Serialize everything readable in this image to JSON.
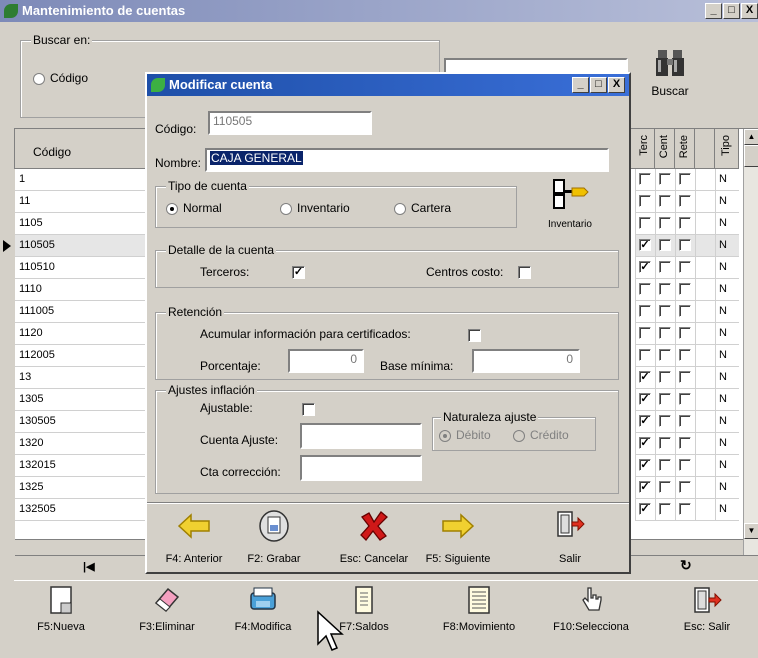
{
  "window": {
    "title": "Mantenimiento de cuentas",
    "buttons": [
      "_",
      "□",
      "X"
    ]
  },
  "search": {
    "legend": "Buscar en:",
    "option_code": "Código",
    "search_button": "Buscar"
  },
  "grid": {
    "col_code": "Código",
    "col_terc": "Terc",
    "col_cent": "Cent",
    "col_rete": "Rete",
    "col_tipo": "Tipo",
    "rows": [
      {
        "code": "1",
        "terc": false,
        "tipo": "N"
      },
      {
        "code": "11",
        "terc": false,
        "tipo": "N"
      },
      {
        "code": "1105",
        "terc": false,
        "tipo": "N"
      },
      {
        "code": "110505",
        "terc": true,
        "tipo": "N"
      },
      {
        "code": "110510",
        "terc": true,
        "tipo": "N"
      },
      {
        "code": "1110",
        "terc": false,
        "tipo": "N"
      },
      {
        "code": "111005",
        "terc": false,
        "tipo": "N"
      },
      {
        "code": "1120",
        "terc": false,
        "tipo": "N"
      },
      {
        "code": "112005",
        "terc": false,
        "tipo": "N"
      },
      {
        "code": "13",
        "terc": true,
        "tipo": "N"
      },
      {
        "code": "1305",
        "terc": true,
        "tipo": "N"
      },
      {
        "code": "130505",
        "terc": true,
        "tipo": "N"
      },
      {
        "code": "1320",
        "terc": true,
        "tipo": "N"
      },
      {
        "code": "132015",
        "terc": true,
        "tipo": "N"
      },
      {
        "code": "1325",
        "terc": true,
        "tipo": "N"
      },
      {
        "code": "132505",
        "terc": true,
        "tipo": "N"
      }
    ],
    "nav_first": "|◀",
    "nav_refresh": "↻"
  },
  "toolbar": [
    {
      "label": "F5:Nueva",
      "icon": "new-document-icon"
    },
    {
      "label": "F3:Eliminar",
      "icon": "eraser-icon"
    },
    {
      "label": "F4:Modifica",
      "icon": "modify-icon"
    },
    {
      "label": "F7:Saldos",
      "icon": "balance-sheet-icon"
    },
    {
      "label": "F8:Movimiento",
      "icon": "ledger-icon"
    },
    {
      "label": "F10:Selecciona",
      "icon": "pointing-hand-icon"
    },
    {
      "label": "Esc: Salir",
      "icon": "exit-door-icon"
    }
  ],
  "dialog": {
    "title": "Modificar cuenta",
    "codigo_label": "Código:",
    "codigo_value": "110505",
    "nombre_label": "Nombre:",
    "nombre_value": "CAJA GENERAL",
    "tipo_legend": "Tipo de cuenta",
    "tipo_normal": "Normal",
    "tipo_inventario": "Inventario",
    "tipo_cartera": "Cartera",
    "inventario_button": "Inventario",
    "detalle_legend": "Detalle de la cuenta",
    "terceros_label": "Terceros:",
    "centros_label": "Centros costo:",
    "retencion_legend": "Retención",
    "acumular_label": "Acumular información para certificados:",
    "porcentaje_label": "Porcentaje:",
    "porcentaje_value": "0",
    "base_label": "Base mínima:",
    "base_value": "0",
    "ajustes_legend": "Ajustes inflación",
    "ajustable_label": "Ajustable:",
    "cuenta_ajuste_label": "Cuenta Ajuste:",
    "cta_correccion_label": "Cta corrección:",
    "naturaleza_legend": "Naturaleza ajuste",
    "debito": "Débito",
    "credito": "Crédito",
    "buttons": [
      {
        "label": "F4: Anterior",
        "icon": "arrow-left-icon"
      },
      {
        "label": "F2: Grabar",
        "icon": "save-icon"
      },
      {
        "label": "Esc: Cancelar",
        "icon": "cancel-x-icon"
      },
      {
        "label": "F5: Siguiente",
        "icon": "arrow-right-icon"
      },
      {
        "label": "Salir",
        "icon": "exit-door-icon"
      }
    ]
  },
  "colors": {
    "title_inactive": "#7d8ab8",
    "title_active": "#1e4fa8",
    "selection": "#0a246a",
    "face": "#d4d0c8"
  }
}
